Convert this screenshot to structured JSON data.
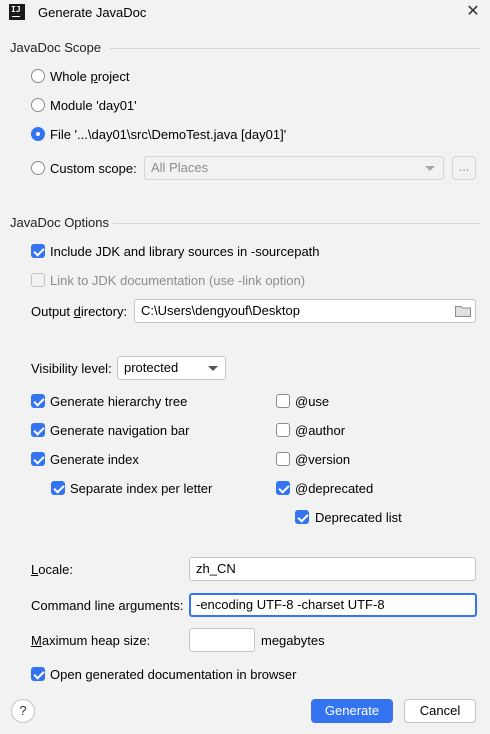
{
  "window": {
    "title": "Generate JavaDoc",
    "icon_text": "IJ"
  },
  "scope": {
    "title": "JavaDoc Scope",
    "whole_project": "Whole project",
    "module": "Module 'day01'",
    "file": "File '...\\day01\\src\\DemoTest.java [day01]'",
    "custom_scope": "Custom scope:",
    "custom_scope_value": "All Places",
    "browse_label": "...",
    "selected": "file"
  },
  "options": {
    "title": "JavaDoc Options",
    "include_jdk": {
      "label": "Include JDK and library sources in -sourcepath",
      "checked": true
    },
    "link_jdk": {
      "label": "Link to JDK documentation (use -link option)",
      "checked": false,
      "enabled": false
    },
    "output_dir": {
      "label": "Output directory:",
      "value": "C:\\Users\\dengyouf\\Desktop"
    },
    "visibility": {
      "label": "Visibility level:",
      "value": "protected"
    },
    "gen_hierarchy": {
      "label": "Generate hierarchy tree",
      "checked": true
    },
    "gen_navbar": {
      "label": "Generate navigation bar",
      "checked": true
    },
    "gen_index": {
      "label": "Generate index",
      "checked": true
    },
    "separate_index": {
      "label": "Separate index per letter",
      "checked": true
    },
    "tag_use": {
      "label": "@use",
      "checked": false
    },
    "tag_author": {
      "label": "@author",
      "checked": false
    },
    "tag_version": {
      "label": "@version",
      "checked": false
    },
    "tag_deprecated": {
      "label": "@deprecated",
      "checked": true
    },
    "deprecated_list": {
      "label": "Deprecated list",
      "checked": true
    },
    "locale": {
      "label": "Locale:",
      "value": "zh_CN"
    },
    "cmd_args": {
      "label": "Command line arguments:",
      "value": "-encoding UTF-8 -charset UTF-8"
    },
    "heap": {
      "label": "Maximum heap size:",
      "value": "",
      "unit": "megabytes"
    },
    "open_browser": {
      "label": "Open generated documentation in browser",
      "checked": true
    }
  },
  "buttons": {
    "help": "?",
    "generate": "Generate",
    "cancel": "Cancel"
  },
  "colors": {
    "accent": "#3574f0",
    "background": "#f2f2f2"
  }
}
